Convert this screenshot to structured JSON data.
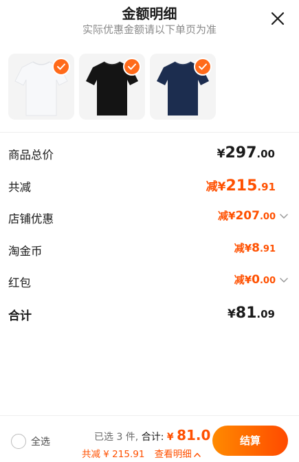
{
  "header": {
    "title": "金额明细",
    "subtitle": "实际优惠金额请以下单页为准"
  },
  "products": [
    {
      "color": "#f5f6f8",
      "selected": true
    },
    {
      "color": "#141414",
      "selected": true
    },
    {
      "color": "#1c2d4f",
      "selected": true
    }
  ],
  "rows": [
    {
      "label": "商品总价",
      "prefix": "",
      "currency": "¥",
      "int": "297",
      "dec": ".00"
    },
    {
      "label": "共减",
      "prefix": "减",
      "currency": "¥",
      "int": "215",
      "dec": ".91"
    },
    {
      "label": "店铺优惠",
      "prefix": "减",
      "currency": "¥",
      "int": "207",
      "dec": ".00"
    },
    {
      "label": "淘金币",
      "prefix": "减",
      "currency": "¥",
      "int": "8",
      "dec": ".91"
    },
    {
      "label": "红包",
      "prefix": "减",
      "currency": "¥",
      "int": "0",
      "dec": ".00"
    },
    {
      "label": "合计",
      "prefix": "",
      "currency": "¥",
      "int": "81",
      "dec": ".09"
    }
  ],
  "footer": {
    "select_all": "全选",
    "selected_count_text": "已选 3 件,",
    "total_label": "合计:",
    "total_currency": "¥",
    "total_amount": "81.0",
    "discount_text": "共减 ¥ 215.91",
    "view_detail": "查看明细",
    "checkout_label": "结算"
  },
  "colors": {
    "accent": "#ff5000",
    "check_badge": "#ff6a1a"
  }
}
